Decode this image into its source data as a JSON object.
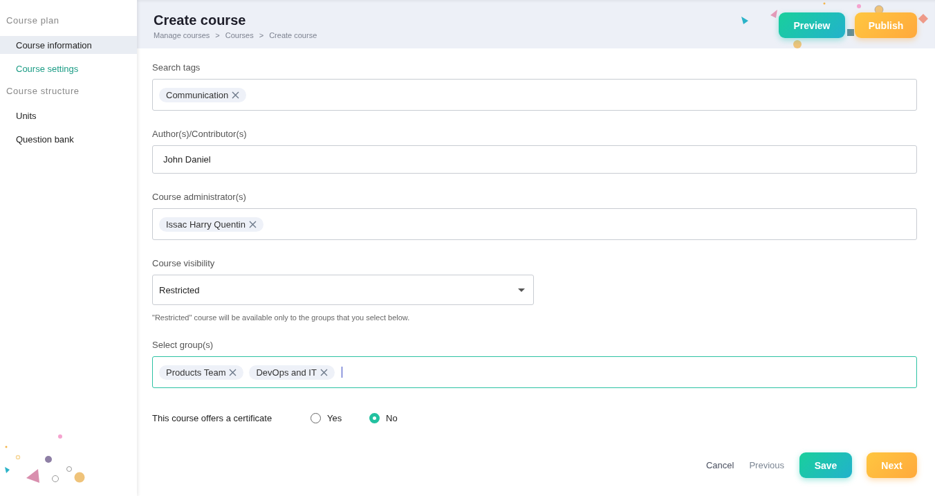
{
  "sidebar": {
    "sections": [
      {
        "heading": "Course plan",
        "items": [
          {
            "label": "Course information",
            "selected": false,
            "highlighted": true
          },
          {
            "label": "Course settings",
            "selected": true,
            "highlighted": false
          }
        ]
      },
      {
        "heading": "Course structure",
        "items": [
          {
            "label": "Units",
            "selected": false,
            "highlighted": false
          },
          {
            "label": "Question bank",
            "selected": false,
            "highlighted": false
          }
        ]
      }
    ]
  },
  "header": {
    "title": "Create course",
    "breadcrumb": [
      "Manage courses",
      "Courses",
      "Create course"
    ],
    "separator": ">",
    "buttons": [
      {
        "label": "Preview",
        "kind": "teal"
      },
      {
        "label": "Publish",
        "kind": "orange"
      }
    ]
  },
  "fields": [
    {
      "kind": "tags",
      "label": "Search tags",
      "focused": false,
      "tags": [
        "Communication"
      ]
    },
    {
      "kind": "text",
      "label": "Author(s)/Contributor(s)",
      "focused": false,
      "value": "John Daniel"
    },
    {
      "kind": "tags",
      "label": "Course administrator(s)",
      "focused": false,
      "tags": [
        "Issac Harry Quentin"
      ]
    },
    {
      "kind": "select",
      "label": "Course visibility",
      "focused": false,
      "value": "Restricted",
      "hint": "\"Restricted\" course will be available only to the groups that you select below."
    },
    {
      "kind": "tags",
      "label": "Select group(s)",
      "focused": true,
      "tags": [
        "Products Team",
        "DevOps and IT"
      ]
    }
  ],
  "certificate": {
    "label": "This course offers a certificate",
    "options": [
      {
        "label": "Yes",
        "selected": false
      },
      {
        "label": "No",
        "selected": true
      }
    ]
  },
  "footer": {
    "links": [
      "Cancel",
      "Previous"
    ],
    "buttons": [
      {
        "label": "Save",
        "kind": "teal"
      },
      {
        "label": "Next",
        "kind": "orange"
      }
    ]
  }
}
